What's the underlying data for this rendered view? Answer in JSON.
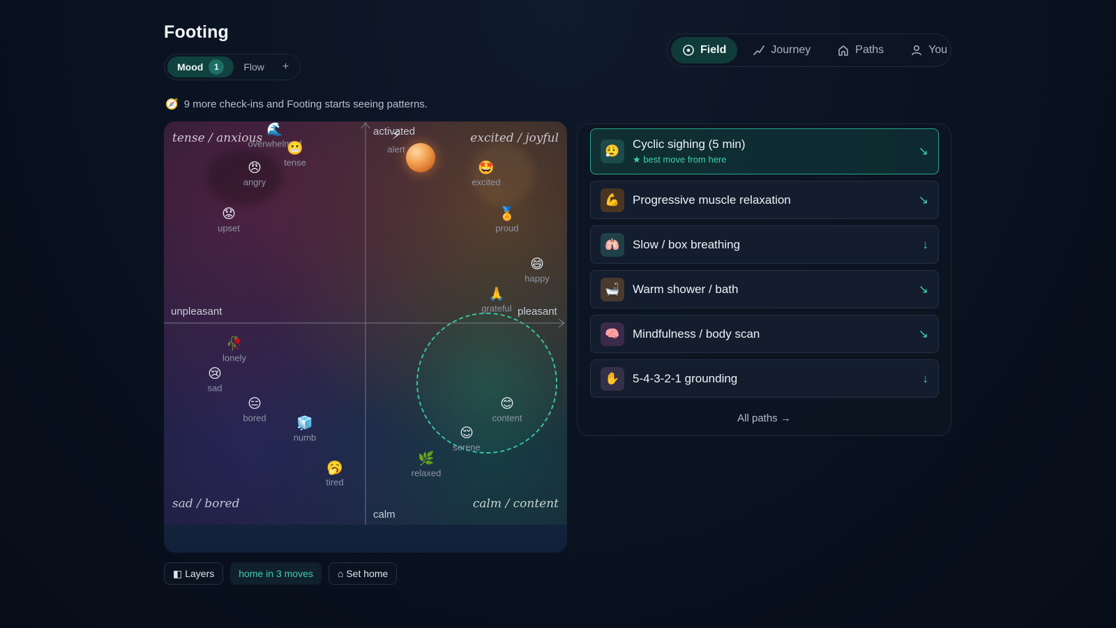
{
  "app": {
    "title": "Footing"
  },
  "view_tabs": [
    {
      "label": "Mood",
      "badge": "1",
      "active": true
    },
    {
      "label": "Flow",
      "active": false
    },
    {
      "label": "+",
      "active": false
    }
  ],
  "nav": [
    {
      "label": "Field",
      "icon": "target-icon",
      "active": true
    },
    {
      "label": "Journey",
      "icon": "trend-line-icon",
      "active": false
    },
    {
      "label": "Paths",
      "icon": "home-icon",
      "active": false
    },
    {
      "label": "You",
      "icon": "person-icon",
      "active": false
    }
  ],
  "hint": {
    "icon": "compass-icon",
    "text": "9 more check-ins and Footing starts seeing patterns."
  },
  "field": {
    "quadrants": {
      "top_left": "tense / anxious",
      "top_right": "excited / joyful",
      "bottom_left": "sad / bored",
      "bottom_right": "calm / content"
    },
    "axes": {
      "top": "activated",
      "bottom": "calm",
      "left": "unpleasant",
      "right": "pleasant"
    },
    "emotions": [
      {
        "id": "overwhelmed",
        "label": "overwhelmed",
        "glyph": "🌊"
      },
      {
        "id": "tense",
        "label": "tense",
        "glyph": "😬"
      },
      {
        "id": "angry",
        "label": "angry",
        "glyph": "😠"
      },
      {
        "id": "upset",
        "label": "upset",
        "glyph": "😟"
      },
      {
        "id": "alert",
        "label": "alert",
        "glyph": "⚡"
      },
      {
        "id": "excited",
        "label": "excited",
        "glyph": "🤩"
      },
      {
        "id": "proud",
        "label": "proud",
        "glyph": "🏅"
      },
      {
        "id": "happy",
        "label": "happy",
        "glyph": "😄"
      },
      {
        "id": "grateful",
        "label": "grateful",
        "glyph": "🙏"
      },
      {
        "id": "lonely",
        "label": "lonely",
        "glyph": "🥀"
      },
      {
        "id": "sad",
        "label": "sad",
        "glyph": "😢"
      },
      {
        "id": "bored",
        "label": "bored",
        "glyph": "😑"
      },
      {
        "id": "numb",
        "label": "numb",
        "glyph": "🧊"
      },
      {
        "id": "tired",
        "label": "tired",
        "glyph": "🥱"
      },
      {
        "id": "content",
        "label": "content",
        "glyph": "😊"
      },
      {
        "id": "serene",
        "label": "serene",
        "glyph": "😌"
      },
      {
        "id": "relaxed",
        "label": "relaxed",
        "glyph": "🌿"
      }
    ],
    "current_position": "alert",
    "home": "content"
  },
  "toolbar": {
    "layers_label": "Layers",
    "home_status": "home in 3 moves",
    "set_home_label": "Set home"
  },
  "paths": {
    "items": [
      {
        "name": "Cyclic sighing (5 min)",
        "sub": "★ best move from here",
        "glyph": "😮‍💨",
        "arrow": "↘",
        "icon_bg": "#1d4a4a",
        "highlighted": true
      },
      {
        "name": "Progressive muscle relaxation",
        "glyph": "💪",
        "arrow": "↘",
        "icon_bg": "#4a3523"
      },
      {
        "name": "Slow / box breathing",
        "glyph": "🫁",
        "arrow": "↓",
        "icon_bg": "#1f4047"
      },
      {
        "name": "Warm shower / bath",
        "glyph": "🛁",
        "arrow": "↘",
        "icon_bg": "#4a3a2e"
      },
      {
        "name": "Mindfulness / body scan",
        "glyph": "🧠",
        "arrow": "↘",
        "icon_bg": "#3b2a4a"
      },
      {
        "name": "5-4-3-2-1 grounding",
        "glyph": "✋",
        "arrow": "↓",
        "icon_bg": "#35304a"
      }
    ],
    "all_label": "All paths →"
  },
  "colors": {
    "accent": "#3fd1ad",
    "background": "#0a1220"
  }
}
